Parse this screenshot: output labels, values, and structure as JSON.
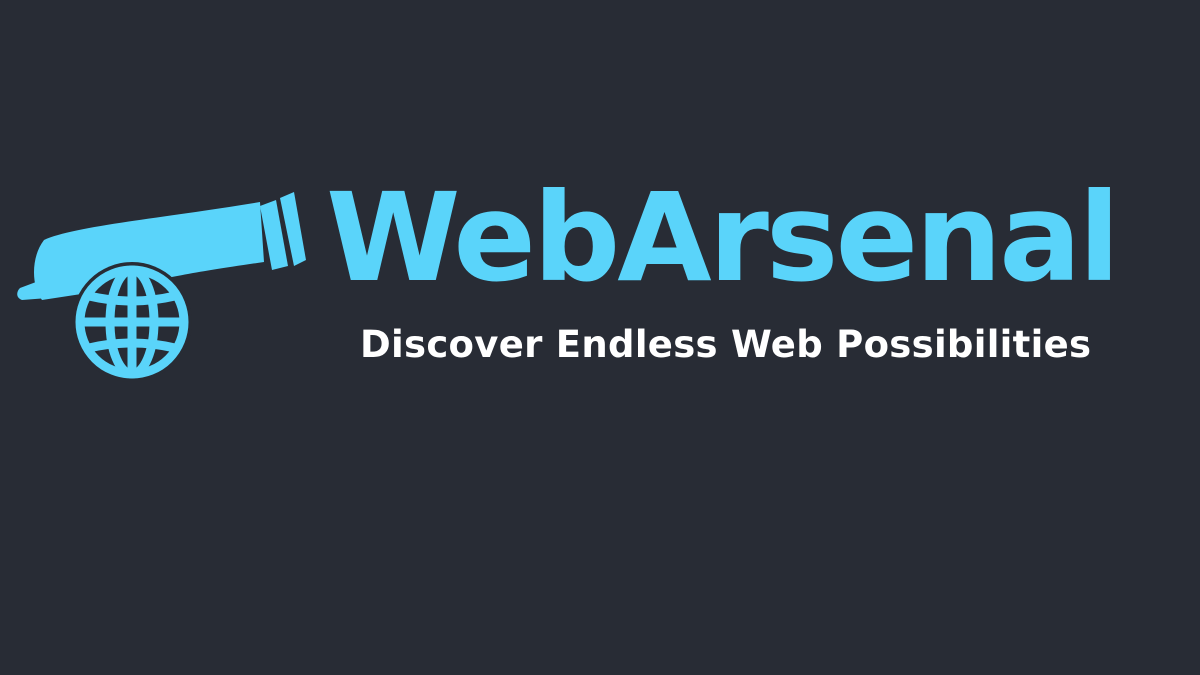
{
  "brand": {
    "name": "WebArsenal",
    "tagline": "Discover Endless Web Possibilities"
  },
  "colors": {
    "background": "#282c35",
    "accent": "#5ad4fa",
    "tagline_text": "#ffffff"
  },
  "logo": {
    "icon": "cannon-globe-icon"
  }
}
